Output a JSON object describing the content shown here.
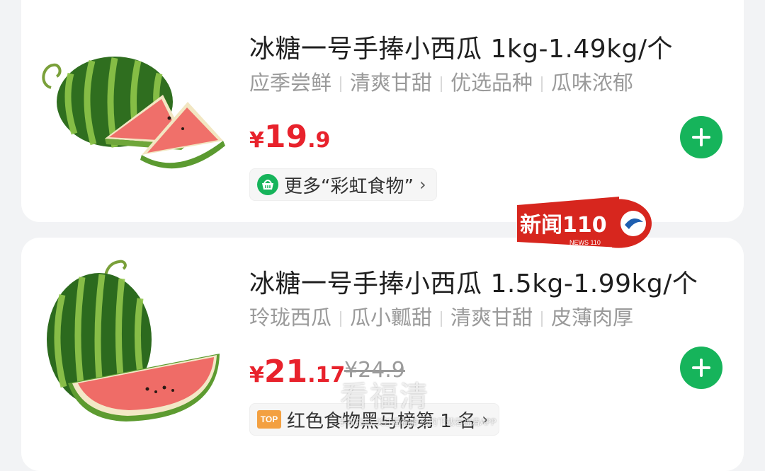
{
  "products": [
    {
      "title": "冰糖一号手捧小西瓜 1kg-1.49kg/个",
      "tags": [
        "应季尝鲜",
        "清爽甘甜",
        "优选品种",
        "瓜味浓郁"
      ],
      "price": {
        "currency": "¥",
        "int": "19",
        "dec": ".9"
      },
      "chip_label": "更多“彩虹食物”",
      "image_icon": "watermelon-slices-image",
      "chip_icon": "basket-icon"
    },
    {
      "title": "冰糖一号手捧小西瓜 1.5kg-1.99kg/个",
      "tags": [
        "玲珑西瓜",
        "瓜小瓤甜",
        "清爽甘甜",
        "皮薄肉厚"
      ],
      "price": {
        "currency": "¥",
        "int": "21",
        "dec": ".17",
        "original": "¥24.9"
      },
      "chip_label": "红色食物黑马榜第 1 名",
      "chip_badge": "TOP",
      "image_icon": "watermelon-wedge-image"
    }
  ],
  "overlay": {
    "logo_text": "新闻110",
    "logo_sub": "NEWS 110",
    "watermark": "看福清",
    "watermark_sub": "手机扫码 关注看福清 您的下载看福清APP"
  },
  "colors": {
    "accent": "#16b45b",
    "price": "#e8222c",
    "background": "#f2f3f5"
  }
}
